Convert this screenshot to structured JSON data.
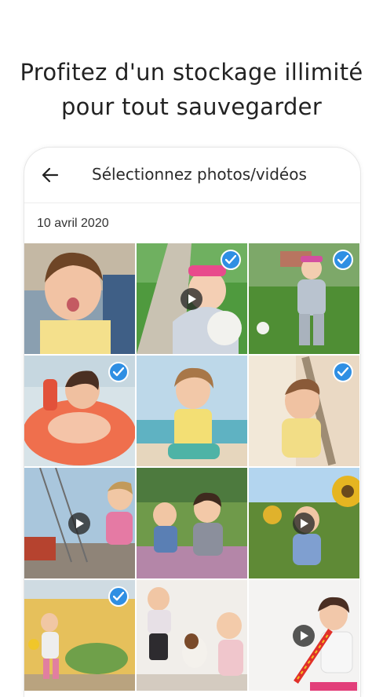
{
  "headline": {
    "line1": "Profitez d'un stockage illimité",
    "line2": "pour tout sauvegarder"
  },
  "selector": {
    "title": "Sélectionnez photos/vidéos",
    "back_icon": "arrow-left-icon",
    "date": "10 avril 2020"
  },
  "colors": {
    "accent": "#2f8fe3"
  },
  "photos": [
    {
      "selected": false,
      "video": false
    },
    {
      "selected": true,
      "video": true
    },
    {
      "selected": true,
      "video": false
    },
    {
      "selected": true,
      "video": false
    },
    {
      "selected": false,
      "video": false
    },
    {
      "selected": true,
      "video": false
    },
    {
      "selected": false,
      "video": true
    },
    {
      "selected": false,
      "video": false
    },
    {
      "selected": false,
      "video": true
    },
    {
      "selected": true,
      "video": false
    },
    {
      "selected": false,
      "video": false
    },
    {
      "selected": false,
      "video": true
    }
  ]
}
